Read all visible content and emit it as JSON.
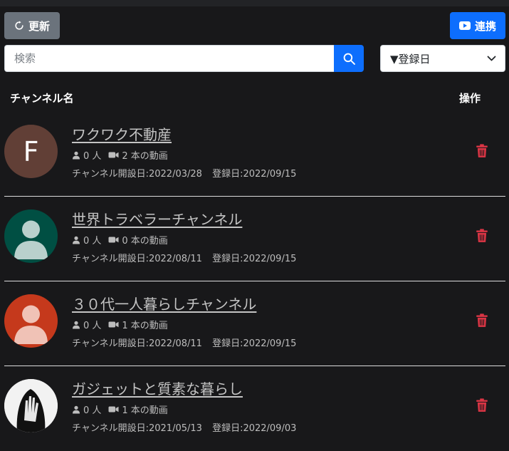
{
  "toolbar": {
    "refresh_label": "更新",
    "link_label": "連携"
  },
  "search": {
    "placeholder": "検索",
    "value": ""
  },
  "sort": {
    "selected": "▼登録日"
  },
  "table": {
    "headers": {
      "name": "チャンネル名",
      "actions": "操作"
    },
    "rows": [
      {
        "title": "ワクワク不動産",
        "subscribers": "0 人",
        "videos": "2 本の動画",
        "created": "チャンネル開設日:2022/03/28",
        "registered": "登録日:2022/09/15",
        "avatar_letter": "F",
        "avatar_color": "#613f36"
      },
      {
        "title": "世界トラベラーチャンネル",
        "subscribers": "0 人",
        "videos": "0 本の動画",
        "created": "チャンネル開設日:2022/08/11",
        "registered": "登録日:2022/09/15",
        "avatar_color": "#004f43"
      },
      {
        "title": "３０代一人暮らしチャンネル",
        "subscribers": "0 人",
        "videos": "1 本の動画",
        "created": "チャンネル開設日:2022/08/11",
        "registered": "登録日:2022/09/15",
        "avatar_color": "#c5391c"
      },
      {
        "title": "ガジェットと質素な暮らし",
        "subscribers": "0 人",
        "videos": "1 本の動画",
        "created": "チャンネル開設日:2021/05/13",
        "registered": "登録日:2022/09/03",
        "avatar_color": "#f2f2f2"
      }
    ]
  },
  "colors": {
    "background": "#18181a",
    "primary": "#0d6efd",
    "secondary": "#6b737c",
    "danger": "#dc3545"
  }
}
